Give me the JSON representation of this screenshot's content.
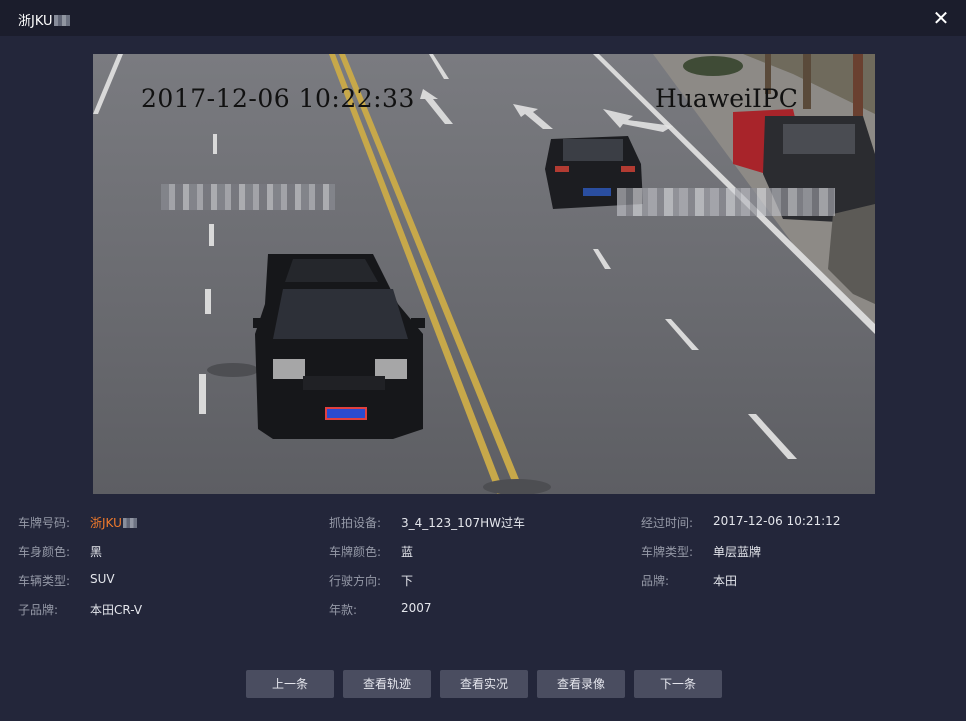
{
  "window": {
    "title": "浙JKU",
    "close_symbol": "✕"
  },
  "photo": {
    "timestamp": "2017-12-06 10:22:33",
    "camera_label": "HuaweiIPC",
    "plate_on_car": "浙JKU22"
  },
  "info": {
    "rows": [
      [
        {
          "label": "车牌号码:",
          "value": "浙JKU"
        },
        {
          "label": "抓拍设备:",
          "value": "3_4_123_107HW过车"
        },
        {
          "label": "经过时间:",
          "value": "2017-12-06 10:21:12"
        }
      ],
      [
        {
          "label": "车身颜色:",
          "value": "黑"
        },
        {
          "label": "车牌颜色:",
          "value": "蓝"
        },
        {
          "label": "车牌类型:",
          "value": "单层蓝牌"
        }
      ],
      [
        {
          "label": "车辆类型:",
          "value": "SUV"
        },
        {
          "label": "行驶方向:",
          "value": "下"
        },
        {
          "label": "品牌:",
          "value": "本田"
        }
      ],
      [
        {
          "label": "子品牌:",
          "value": "本田CR-V"
        },
        {
          "label": "年款:",
          "value": "2007"
        }
      ]
    ]
  },
  "buttons": {
    "prev": "上一条",
    "track": "查看轨迹",
    "live": "查看实况",
    "recording": "查看录像",
    "next": "下一条"
  },
  "colors": {
    "background": "#23263a",
    "titlebar": "#1b1d2c",
    "plate_highlight": "#f07a2c",
    "button": "#4a4d60"
  }
}
